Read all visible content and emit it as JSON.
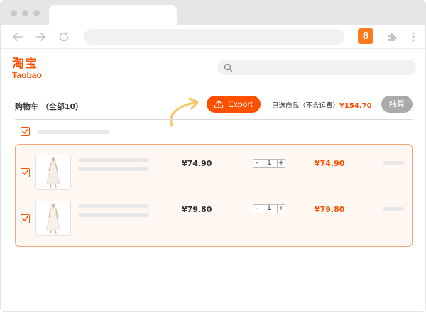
{
  "browser": {
    "extension_badge": "8",
    "icons": [
      "back-arrow-icon",
      "forward-arrow-icon",
      "reload-icon",
      "puzzle-icon",
      "kebab-menu-icon"
    ]
  },
  "logo": {
    "cn": "淘宝",
    "en": "Taobao"
  },
  "cart": {
    "title": "购物车 （全部10）",
    "export_label": "Export",
    "selected_label": "已选商品（不含运费）",
    "selected_total": "¥154.70",
    "checkout_label": "结算"
  },
  "items": [
    {
      "price": "¥74.90",
      "quantity": "1",
      "minus": "-",
      "plus": "+",
      "subtotal": "¥74.90"
    },
    {
      "price": "¥79.80",
      "quantity": "1",
      "minus": "-",
      "plus": "+",
      "subtotal": "¥79.80"
    }
  ],
  "colors": {
    "accent": "#ff5000",
    "arrow": "#f7c96a",
    "checkout_disabled": "#aaaaaa"
  }
}
